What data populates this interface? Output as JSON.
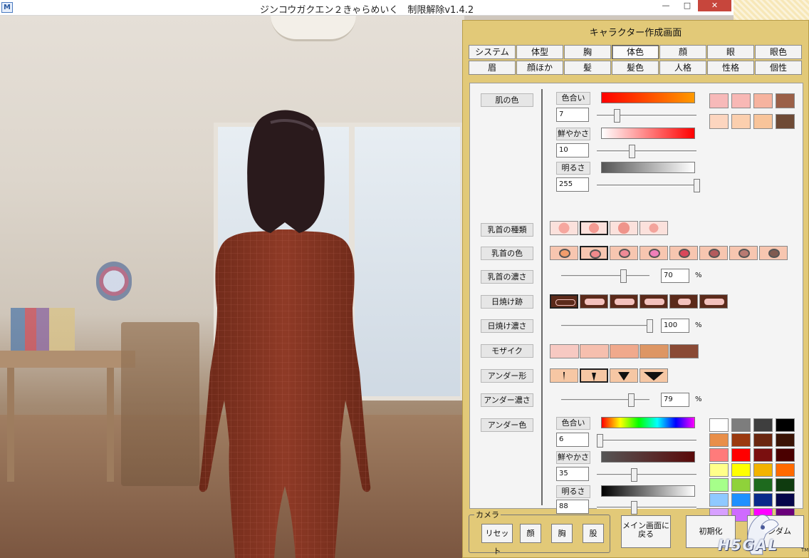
{
  "window": {
    "title": "ジンコウガクエン２きゃらめいく　制限解除v1.4.2",
    "app_icon": "M",
    "min_glyph": "—",
    "max_glyph": "□",
    "close_glyph": "✕"
  },
  "panel": {
    "title": "キャラクター作成画面",
    "tabs": [
      "システム",
      "体型",
      "胸",
      "体色",
      "顔",
      "眼",
      "眼色",
      "眉",
      "顔ほか",
      "髪",
      "髪色",
      "人格",
      "性格",
      "個性"
    ],
    "active_tab": "体色"
  },
  "skin": {
    "label": "肌の色",
    "hue_label": "色合い",
    "hue_value": 7,
    "hue_slider_fraction": 0.2,
    "sat_label": "鮮やかさ",
    "sat_value": 10,
    "sat_slider_fraction": 0.35,
    "bri_label": "明るさ",
    "bri_value": 255,
    "bri_slider_fraction": 1.0,
    "presets": [
      "#f7b9b9",
      "#f8b8b5",
      "#f6b39f",
      "#9b6048",
      "#fcd5bf",
      "#fbcfae",
      "#f8c49a",
      "#6e4a35"
    ]
  },
  "nipple_type": {
    "label": "乳首の種類",
    "selected_index": 1
  },
  "nipple_color": {
    "label": "乳首の色",
    "selected_index": 1,
    "colors": [
      "#f29d6c",
      "#f08a8c",
      "#ef8a96",
      "#ef7fb9",
      "#d9475a",
      "#b35a5c",
      "#b87a72",
      "#7f5a50"
    ]
  },
  "nipple_density": {
    "label": "乳首の濃さ",
    "value": 70,
    "unit": "%"
  },
  "tan_lines": {
    "label": "日焼け跡",
    "selected_index": 0
  },
  "tan_density": {
    "label": "日焼け濃さ",
    "value": 100,
    "unit": "%"
  },
  "mosaic": {
    "label": "モザイク",
    "colors": [
      "#f7c9c2",
      "#f6bfae",
      "#f0a98c",
      "#dd9664",
      "#8a4a35"
    ]
  },
  "under_shape": {
    "label": "アンダー形",
    "selected_index": 1
  },
  "under_density": {
    "label": "アンダー濃さ",
    "value": 79,
    "unit": "%"
  },
  "under_color": {
    "label": "アンダー色",
    "hue_label": "色合い",
    "hue_value": 6,
    "hue_slider_fraction": 0.03,
    "sat_label": "鮮やかさ",
    "sat_value": 35,
    "sat_slider_fraction": 0.37,
    "bri_label": "明るさ",
    "bri_value": 88,
    "bri_slider_fraction": 0.37,
    "palette": [
      "#ffffff",
      "#7d7d7d",
      "#3e3e3e",
      "#000000",
      "#e98f4a",
      "#9b3a10",
      "#6a2710",
      "#3a1406",
      "#ff7b7b",
      "#ff0000",
      "#7a0f0f",
      "#4a0000",
      "#ffff8a",
      "#ffff00",
      "#f2b300",
      "#ff6a00",
      "#a6ff8a",
      "#8fd23a",
      "#1e6a1e",
      "#0f3b0f",
      "#8fc9ff",
      "#1e90ff",
      "#0a2a8a",
      "#06064a",
      "#d7a0ff",
      "#cf6aff",
      "#ff00ff",
      "#6a007a"
    ]
  },
  "camera": {
    "group_label": "カメラ",
    "reset": "リセット",
    "face": "顔",
    "chest": "胸",
    "crotch": "股"
  },
  "footer": {
    "main_return_line1": "メイン画面に",
    "main_return_line2": "戻る",
    "initialize": "初期化",
    "random": "ランダム"
  },
  "logo": {
    "text": "H5GAL",
    "tm": "TM"
  },
  "colors": {
    "panel_bg": "#e2c978",
    "content_bg": "#f4f4f4"
  }
}
